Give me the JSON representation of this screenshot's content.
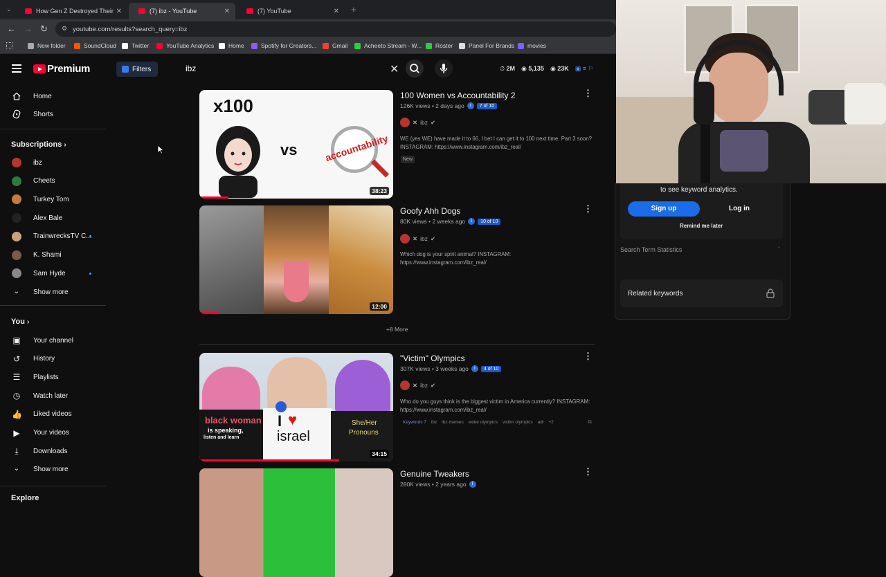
{
  "browser": {
    "tabs": [
      {
        "title": "How Gen Z Destroyed Their 20s",
        "active": false
      },
      {
        "title": "(7) ibz - YouTube",
        "active": true
      },
      {
        "title": "(7) YouTube",
        "active": false
      }
    ],
    "url": "youtube.com/results?search_query=ibz",
    "bookmarks": [
      {
        "label": "New folder",
        "color": "#aaaaaa"
      },
      {
        "label": "SoundCloud",
        "color": "#ff5500"
      },
      {
        "label": "Twitter",
        "color": "#ffffff"
      },
      {
        "label": "YouTube Analytics",
        "color": "#ff0033"
      },
      {
        "label": "Home",
        "color": "#ffffff"
      },
      {
        "label": "Spotify for Creators...",
        "color": "#8b5cf6"
      },
      {
        "label": "Gmail",
        "color": "#ea4335"
      },
      {
        "label": "Acheeto Stream - W...",
        "color": "#2ecc40"
      },
      {
        "label": "Roster",
        "color": "#2ecc40"
      },
      {
        "label": "Panel For Brands",
        "color": "#dddddd"
      },
      {
        "label": "movies",
        "color": "#7b61ff"
      }
    ]
  },
  "header": {
    "brand": "Premium",
    "filters_label": "Filters",
    "search_value": "ibz",
    "stats": [
      "2M",
      "5,135",
      "23K"
    ]
  },
  "sidebar": {
    "main": [
      {
        "label": "Home",
        "icon": "home-icon"
      },
      {
        "label": "Shorts",
        "icon": "shorts-icon"
      }
    ],
    "subscriptions_heading": "Subscriptions",
    "subscriptions": [
      {
        "label": "ibz",
        "color": "#b8342f",
        "live": false
      },
      {
        "label": "Cheets",
        "color": "#2f7a3a",
        "live": false
      },
      {
        "label": "Turkey Tom",
        "color": "#c97a3a",
        "live": false
      },
      {
        "label": "Alex Bale",
        "color": "#222222",
        "live": false
      },
      {
        "label": "TrainwrecksTV C...",
        "color": "#c9a27a",
        "live": true
      },
      {
        "label": "K. Shami",
        "color": "#7a5a4a",
        "live": false
      },
      {
        "label": "Sam Hyde",
        "color": "#888888",
        "live": true
      }
    ],
    "show_more_1": "Show more",
    "you_heading": "You",
    "you_items": [
      {
        "label": "Your channel",
        "icon": "channel-icon"
      },
      {
        "label": "History",
        "icon": "history-icon"
      },
      {
        "label": "Playlists",
        "icon": "playlists-icon"
      },
      {
        "label": "Watch later",
        "icon": "watch-later-icon"
      },
      {
        "label": "Liked videos",
        "icon": "liked-icon"
      },
      {
        "label": "Your videos",
        "icon": "your-videos-icon"
      },
      {
        "label": "Downloads",
        "icon": "downloads-icon"
      }
    ],
    "show_more_2": "Show more",
    "explore_heading": "Explore"
  },
  "results": [
    {
      "title": "100 Women vs Accountability 2",
      "meta": "126K views • 2 days ago",
      "rank": "7 of 10",
      "channel": "ibz",
      "description": "WE (yes WE) have made it to 66, I bet I can get it to 100 next time. Part 3 soon? INSTAGRAM: https://www.instagram.com/ibz_real/",
      "tag": "New",
      "duration": "38:23",
      "progress": 0.15,
      "thumb_text": [
        "x100",
        "vs",
        "accountability"
      ]
    },
    {
      "title": "Goofy Ahh Dogs",
      "meta": "80K views • 2 weeks ago",
      "rank": "10 of 10",
      "channel": "ibz",
      "description": "Which dog is your spirit animal? INSTAGRAM: https://www.instagram.com/ibz_real/",
      "duration": "12:00",
      "progress": 0.1
    },
    {
      "title": "\"Victim\" Olympics",
      "meta": "307K views • 3 weeks ago",
      "rank": "4 of 10",
      "channel": "ibz",
      "description": "Who do you guys think is the biggest victim in America currently? INSTAGRAM: https://www.instagram.com/ibz_real/",
      "keywords_label": "Keywords 7",
      "keywords": [
        "ibz",
        "ibz memes",
        "woke olympics",
        "victim olympics",
        "adl",
        "+2"
      ],
      "duration": "34:15",
      "progress": 0.72,
      "thumb_text": [
        "black woman",
        "is speaking,",
        "listen and learn",
        "I",
        "israel",
        "She/Her",
        "Pronouns"
      ]
    },
    {
      "title": "Genuine Tweakers",
      "meta": "280K views • 2 years ago"
    }
  ],
  "more_label": "+8 More",
  "panel": {
    "prompt": "to see keyword analytics.",
    "signup": "Sign up",
    "login": "Log in",
    "remind": "Remind me later",
    "section1": "Search Term Statistics",
    "section2": "Related keywords"
  }
}
